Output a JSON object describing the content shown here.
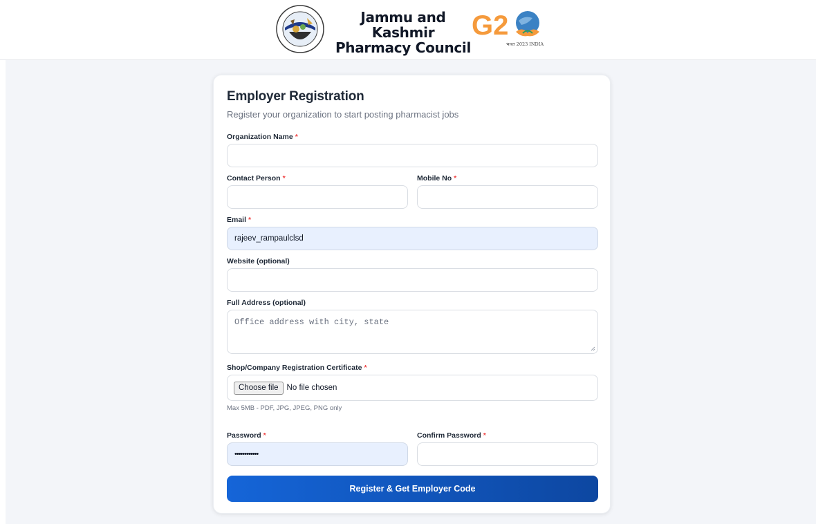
{
  "header": {
    "title_line1": "Jammu and Kashmir",
    "title_line2": "Pharmacy Council",
    "g20_text": "G20",
    "g20_subtext": "भारत 2023 INDIA",
    "logo_ring_text": "JAMMU AND KASHMIR PHARMACY COUNCIL"
  },
  "form": {
    "title": "Employer Registration",
    "subtitle": "Register your organization to start posting pharmacist jobs",
    "required_mark": "*",
    "fields": {
      "org_name": {
        "label": "Organization Name",
        "value": ""
      },
      "contact_person": {
        "label": "Contact Person",
        "value": ""
      },
      "mobile": {
        "label": "Mobile No",
        "value": ""
      },
      "email": {
        "label": "Email",
        "value": "rajeev_rampaulclsd"
      },
      "website": {
        "label": "Website (optional)",
        "value": ""
      },
      "address": {
        "label": "Full Address (optional)",
        "placeholder": "Office address with city, state"
      },
      "certificate": {
        "label": "Shop/Company Registration Certificate",
        "button": "Choose file",
        "status": "No file chosen",
        "hint": "Max 5MB - PDF, JPG, JPEG, PNG only"
      },
      "password": {
        "label": "Password",
        "value": "••••••••••••"
      },
      "confirm_password": {
        "label": "Confirm Password",
        "value": ""
      }
    },
    "submit_label": "Register & Get Employer Code"
  },
  "colors": {
    "accent_start": "#1565d8",
    "accent_end": "#0d47a1",
    "required": "#ef4444",
    "autofill_bg": "#e8f0fe",
    "page_bg": "#f3f5f9"
  }
}
